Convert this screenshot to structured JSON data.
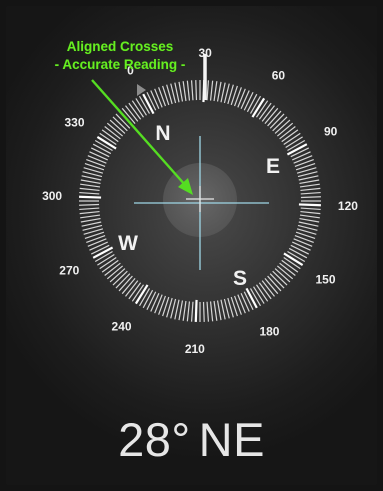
{
  "annotation": {
    "line1": "Aligned Crosses",
    "line2": "- Accurate Reading -"
  },
  "compass": {
    "heading_deg": 28,
    "degree_labels": [
      "0",
      "30",
      "60",
      "90",
      "120",
      "150",
      "180",
      "210",
      "240",
      "270",
      "300",
      "330"
    ],
    "cardinals": {
      "north": "N",
      "east": "E",
      "south": "S",
      "west": "W"
    }
  },
  "reading": {
    "degrees": "28°",
    "direction": "NE"
  },
  "colors": {
    "annotation": "#66ee22",
    "arrow": "#55dd22",
    "text": "#f0f0f0"
  }
}
